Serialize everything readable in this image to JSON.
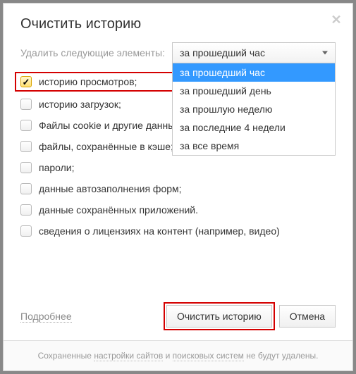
{
  "title": "Очистить историю",
  "period_label": "Удалить следующие элементы:",
  "select": {
    "value": "за прошедший час",
    "options": [
      "за прошедший час",
      "за прошедший день",
      "за прошлую неделю",
      "за последние 4 недели",
      "за все время"
    ]
  },
  "items": [
    {
      "label": "историю просмотров;",
      "checked": true,
      "highlighted": true
    },
    {
      "label": "историю загрузок;",
      "checked": false
    },
    {
      "label": "Файлы cookie и другие данные сайтов и модулей;",
      "checked": false
    },
    {
      "label": "файлы, сохранённые в кэше;",
      "checked": false
    },
    {
      "label": "пароли;",
      "checked": false
    },
    {
      "label": "данные автозаполнения форм;",
      "checked": false
    },
    {
      "label": "данные сохранённых приложений.",
      "checked": false
    },
    {
      "label": "сведения о лицензиях на контент (например, видео)",
      "checked": false
    }
  ],
  "more_link": "Подробнее",
  "buttons": {
    "clear": "Очистить историю",
    "cancel": "Отмена"
  },
  "info": {
    "t1": "Сохраненные ",
    "l1": "настройки сайтов",
    "t2": " и ",
    "l2": "поисковых систем",
    "t3": " не будут удалены."
  }
}
